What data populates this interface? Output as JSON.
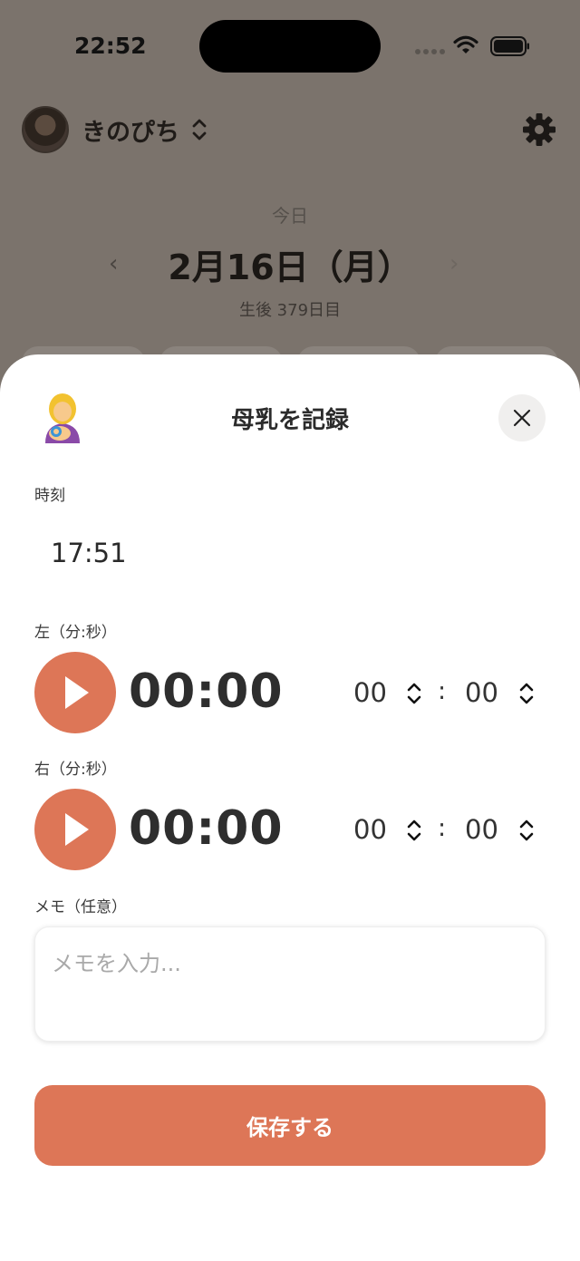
{
  "status_bar": {
    "time": "22:52"
  },
  "header": {
    "profile_name": "きのぴち",
    "today_label": "今日",
    "date_title": "2月16日（月）",
    "prev_symbol": "‹",
    "next_symbol": "›",
    "age_label": "生後 379日目"
  },
  "sheet": {
    "title": "母乳を記録",
    "time_label": "時刻",
    "time_value": "17:51",
    "left": {
      "label": "左（分:秒）",
      "timer": "00:00",
      "minutes": "00",
      "seconds": "00"
    },
    "right": {
      "label": "右（分:秒）",
      "timer": "00:00",
      "minutes": "00",
      "seconds": "00"
    },
    "colon": ":",
    "memo_label": "メモ（任意）",
    "memo_placeholder": "メモを入力...",
    "memo_value": "",
    "save_label": "保存する"
  },
  "colors": {
    "accent": "#dd7657",
    "overlay_bg": "#7b736c",
    "sheet_bg": "#ffffff"
  },
  "icons": [
    "wifi-icon",
    "battery-icon",
    "chevron-updown-icon",
    "gear-icon",
    "breastfeeding-emoji-icon",
    "close-icon",
    "play-icon"
  ]
}
